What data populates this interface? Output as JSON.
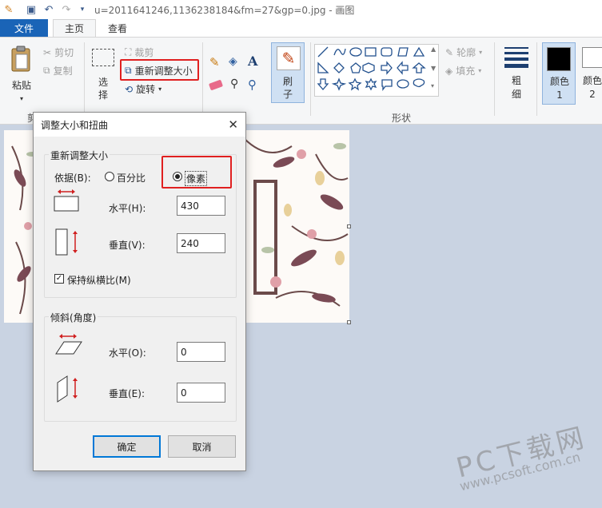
{
  "window": {
    "title": "u=2011641246,1136238184&fm=27&gp=0.jpg - 画图"
  },
  "tabs": {
    "file": "文件",
    "home": "主页",
    "view": "查看"
  },
  "ribbon": {
    "clipboard": {
      "paste": "粘贴",
      "cut": "剪切",
      "copy": "复制"
    },
    "image": {
      "select": "选择",
      "crop": "裁剪",
      "resize": "重新调整大小",
      "rotate": "旋转"
    },
    "brushes": {
      "label": "刷子"
    },
    "shapes": {
      "label": "形状",
      "outline": "轮廓",
      "fill": "填充"
    },
    "size": {
      "label": "粗细"
    },
    "color1": {
      "label": "颜色 1"
    },
    "color2": {
      "label": "颜色 2"
    },
    "group_label_clipboard": "剪"
  },
  "dialog": {
    "title": "调整大小和扭曲",
    "resize_group": "重新调整大小",
    "by_label": "依据(B):",
    "percent_label": "百分比",
    "pixel_label": "像素",
    "horizontal_label": "水平(H):",
    "horizontal_value": "430",
    "vertical_label": "垂直(V):",
    "vertical_value": "240",
    "keep_ratio_label": "保持纵横比(M)",
    "skew_group": "倾斜(角度)",
    "skew_horizontal_label": "水平(O):",
    "skew_horizontal_value": "0",
    "skew_vertical_label": "垂直(E):",
    "skew_vertical_value": "0",
    "ok": "确定",
    "cancel": "取消"
  },
  "watermark": {
    "brand": "PC下载网",
    "url": "www.pcsoft.com.cn"
  },
  "colors": {
    "accent": "#1a64b7",
    "highlight": "#e02020"
  }
}
